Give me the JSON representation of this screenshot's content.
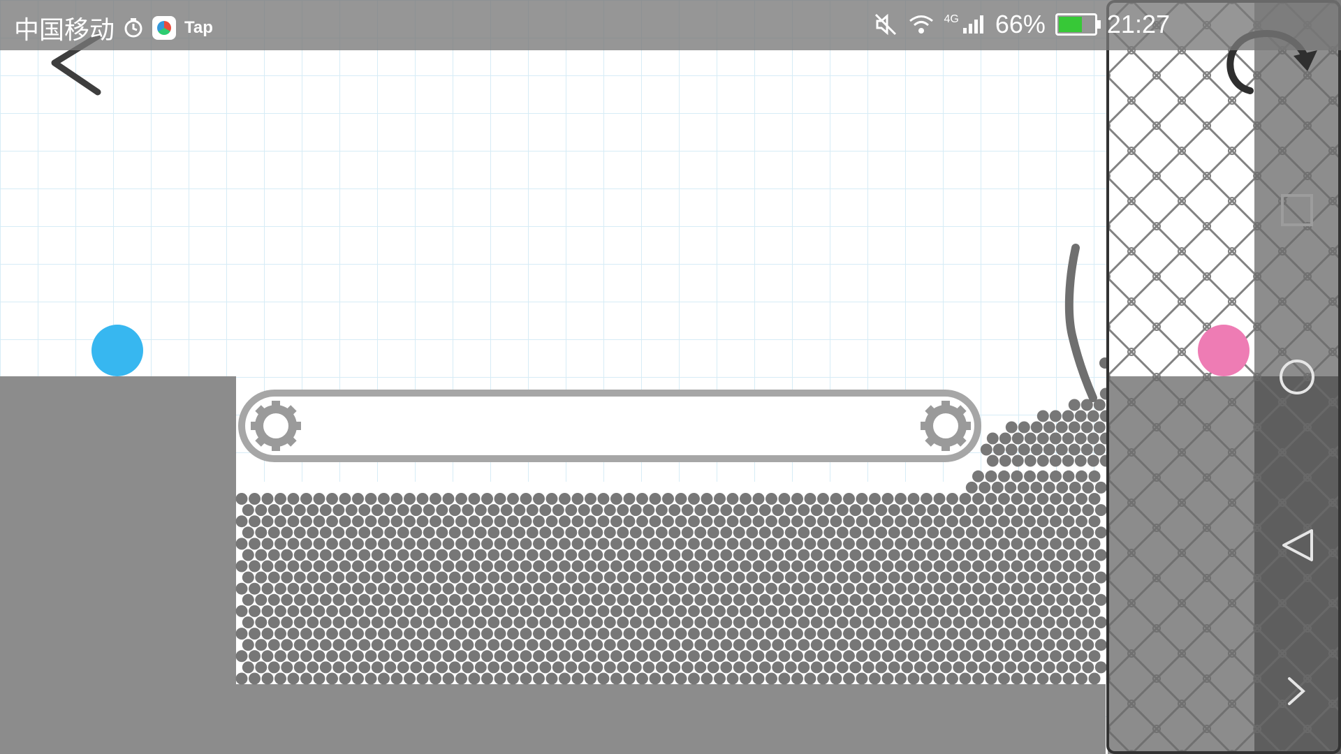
{
  "status_bar": {
    "carrier": "中国移动",
    "app_label": "Tap",
    "network": "4G",
    "battery_percent": "66%",
    "battery_level": 0.66,
    "time": "21:27"
  },
  "colors": {
    "grid_bg": "#ffffff",
    "grid_line": "#d6ecf6",
    "ground": "#8c8c8c",
    "pool_bg": "#ffffff",
    "particle": "#777777",
    "blue_ball": "#37b7f0",
    "pink_ball": "#ee7cb4",
    "conveyor": "#a8a8a8",
    "nav_panel": "#5e5e5e",
    "fence": "#666666"
  },
  "icons": {
    "back": "chevron-left-icon",
    "restart": "restart-arrow-icon",
    "recent_apps": "square-icon",
    "home": "circle-icon",
    "system_back": "triangle-left-icon",
    "expand": "chevron-right-icon",
    "gear": "gear-icon",
    "mute": "mute-icon",
    "wifi": "wifi-icon",
    "signal": "signal-icon",
    "alarm": "alarm-icon",
    "battery": "battery-icon"
  }
}
